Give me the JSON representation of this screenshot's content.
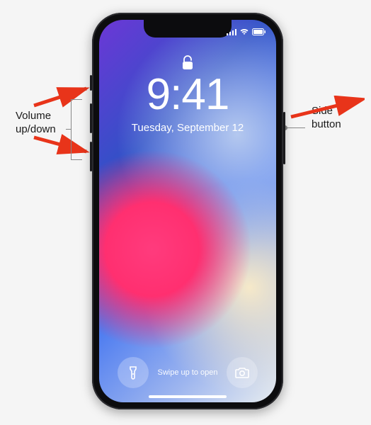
{
  "labels": {
    "volume": "Volume up/down",
    "side": "Side button"
  },
  "lockscreen": {
    "time": "9:41",
    "date": "Tuesday, September 12",
    "swipe": "Swipe up to open"
  },
  "icons": {
    "lock": "lock-icon",
    "flashlight": "flashlight-icon",
    "camera": "camera-icon",
    "signal": "signal-icon",
    "wifi": "wifi-icon",
    "battery": "battery-icon"
  }
}
